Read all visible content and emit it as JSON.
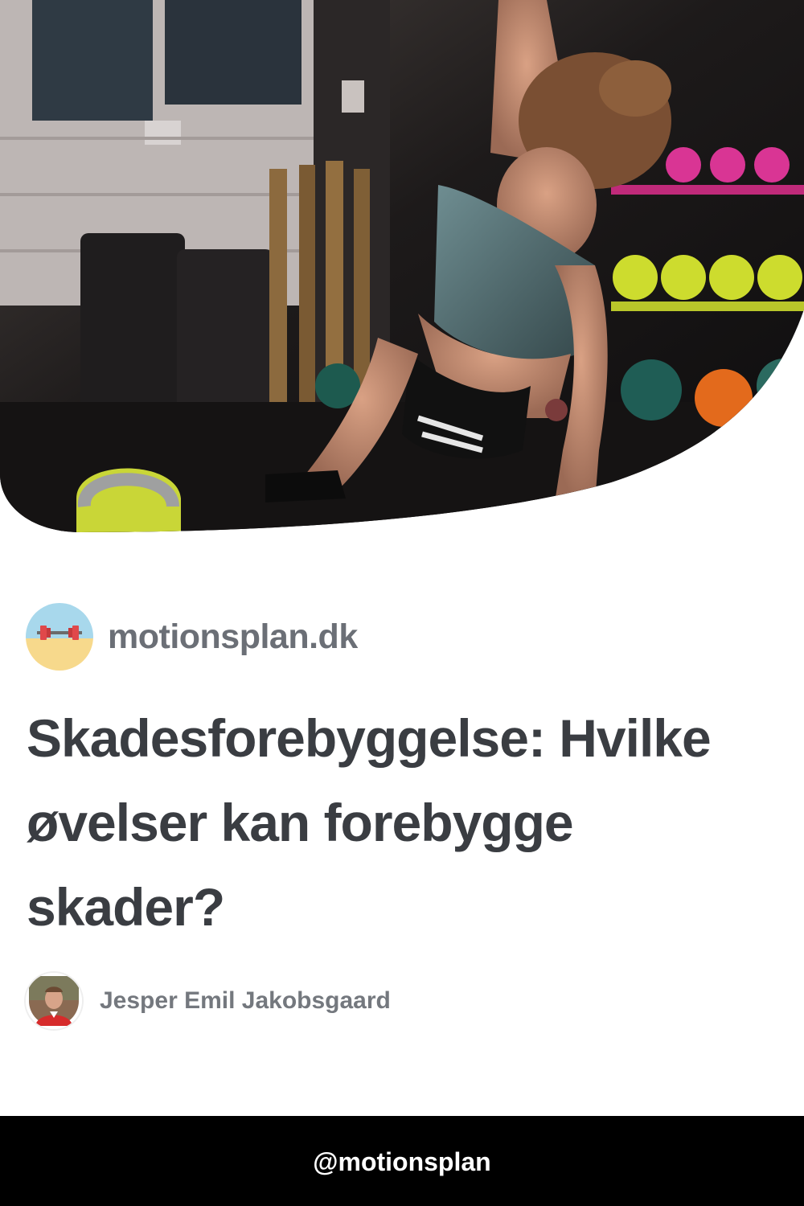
{
  "hero": {
    "image": "gym-photo-woman-side-plank-kettlebells"
  },
  "site": {
    "logo_icon": "barbell-beach-icon",
    "name": "motionsplan.dk"
  },
  "article": {
    "title": "Skadesforebyggelse: Hvilke øvelser kan forebygge skader?"
  },
  "author": {
    "avatar": "author-avatar-photo",
    "name": "Jesper Emil Jakobsgaard"
  },
  "footer": {
    "handle": "@motionsplan"
  },
  "colors": {
    "title": "#3a3d42",
    "site_name": "#6b6f76",
    "author_name": "#74787e",
    "footer_bg": "#000000",
    "footer_text": "#ffffff"
  }
}
